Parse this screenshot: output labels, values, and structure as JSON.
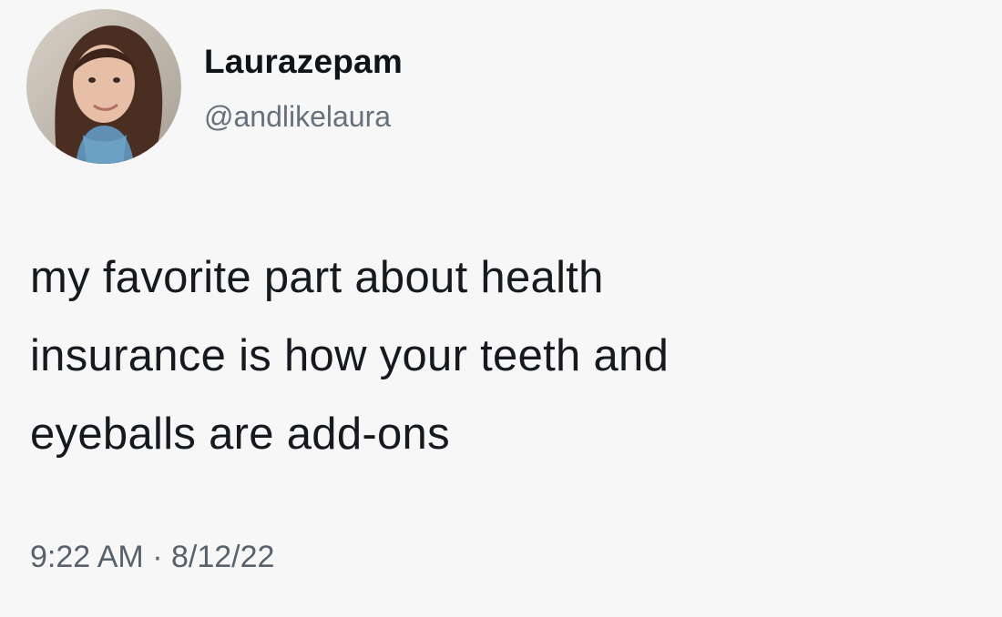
{
  "user": {
    "display_name": "Laurazepam",
    "handle": "@andlikelaura"
  },
  "tweet": {
    "lines": [
      "my favorite part about health",
      "insurance is how your teeth and",
      "eyeballs are add-ons"
    ],
    "timestamp": "9:22 AM · 8/12/22"
  },
  "colors": {
    "background": "#f7f7f8",
    "text": "#0f1419",
    "secondary_text": "#66717b"
  }
}
